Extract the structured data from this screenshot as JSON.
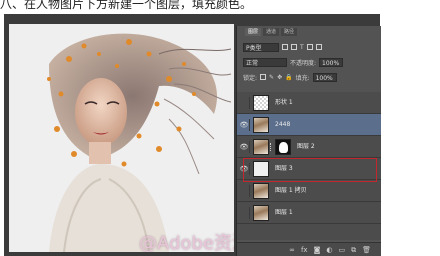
{
  "instruction": "八、在人物图片下方新建一个图层，填充颜色。",
  "watermark": "@Adobe资源库",
  "panel": {
    "tabs": [
      "图层",
      "通道",
      "路径"
    ],
    "filter_kind": "P类型",
    "blend_mode": "正常",
    "opacity_label": "不透明度:",
    "opacity_value": "100%",
    "lock_label": "锁定:",
    "fill_label": "填充:",
    "fill_value": "100%",
    "layers": [
      {
        "name": "形状 1",
        "type": "shape",
        "visible": false
      },
      {
        "name": "2448",
        "type": "smart-object",
        "visible": true,
        "selected": true
      },
      {
        "name": "图层 2",
        "type": "masked",
        "visible": true
      },
      {
        "name": "图层 3",
        "type": "fill",
        "visible": true,
        "highlighted": true
      },
      {
        "name": "图层 1 拷贝",
        "type": "pixel",
        "visible": false
      },
      {
        "name": "图层 1",
        "type": "pixel",
        "visible": false
      }
    ],
    "footer_icons": [
      "link-icon",
      "fx-icon",
      "mask-icon",
      "adjustment-icon",
      "folder-icon",
      "new-layer-icon",
      "trash-icon"
    ]
  },
  "colors": {
    "panel_bg": "#535353",
    "selected_row": "#5b6e8c",
    "highlight_border": "#c2272d"
  }
}
